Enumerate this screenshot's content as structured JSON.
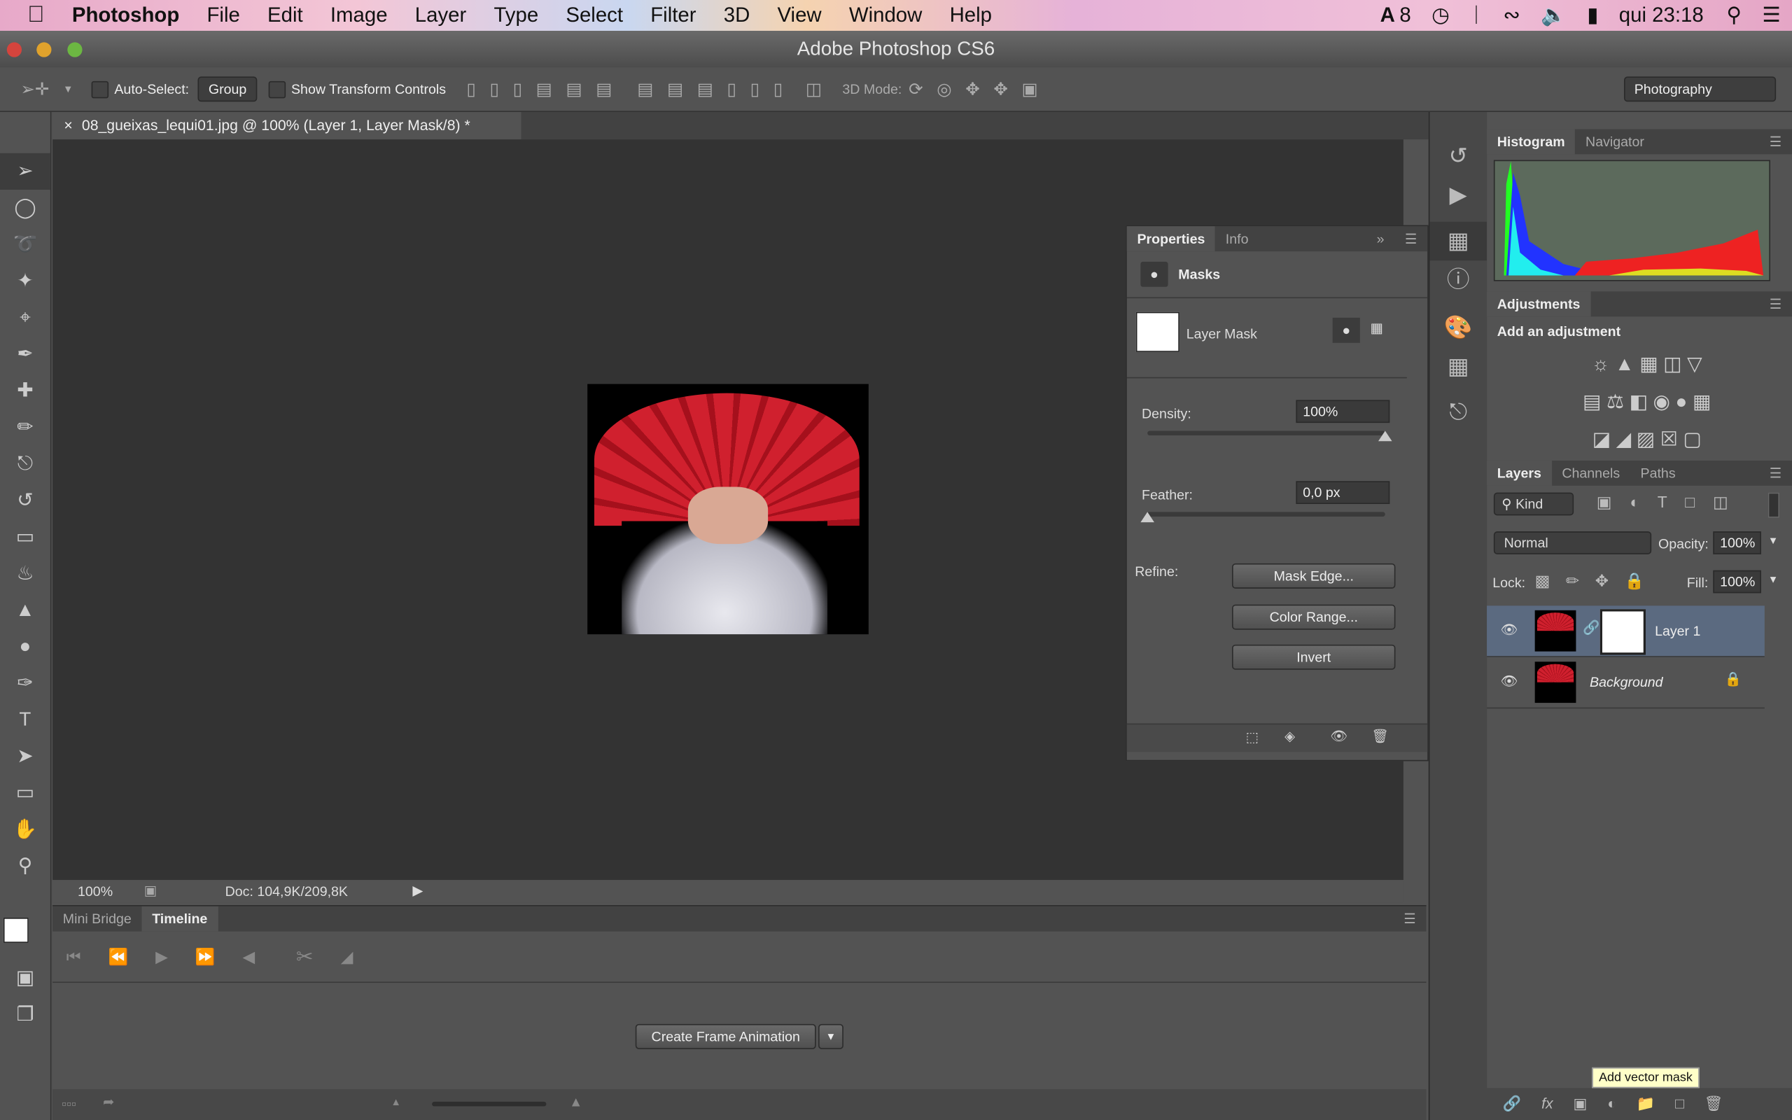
{
  "menubar": {
    "app": "Photoshop",
    "items": [
      "File",
      "Edit",
      "Image",
      "Layer",
      "Type",
      "Select",
      "Filter",
      "3D",
      "View",
      "Window",
      "Help"
    ],
    "adobe_count": "8",
    "clock": "qui 23:18"
  },
  "window": {
    "title": "Adobe Photoshop CS6"
  },
  "options": {
    "auto_select": "Auto-Select:",
    "auto_select_value": "Group",
    "show_transform": "Show Transform Controls",
    "mode_3d": "3D Mode:",
    "workspace": "Photography"
  },
  "document": {
    "tab": "08_gueixas_lequi01.jpg @ 100% (Layer 1, Layer Mask/8) *",
    "zoom": "100%",
    "doc_size": "Doc: 104,9K/209,8K"
  },
  "timeline": {
    "tabs": [
      "Mini Bridge",
      "Timeline"
    ],
    "create_button": "Create Frame Animation"
  },
  "properties": {
    "tabs": [
      "Properties",
      "Info"
    ],
    "section": "Masks",
    "mask_label": "Layer Mask",
    "density_label": "Density:",
    "density": "100%",
    "density_value": 100,
    "feather_label": "Feather:",
    "feather": "0,0 px",
    "feather_value": 0,
    "refine_label": "Refine:",
    "buttons": [
      "Mask Edge...",
      "Color Range...",
      "Invert"
    ]
  },
  "histogram": {
    "tabs": [
      "Histogram",
      "Navigator"
    ]
  },
  "adjustments": {
    "title": "Adjustments",
    "subtitle": "Add an adjustment"
  },
  "layers": {
    "tabs": [
      "Layers",
      "Channels",
      "Paths"
    ],
    "filter": "Kind",
    "blend": "Normal",
    "opacity_label": "Opacity:",
    "opacity": "100%",
    "lock_label": "Lock:",
    "fill_label": "Fill:",
    "fill": "100%",
    "items": [
      {
        "name": "Layer 1",
        "selected": true
      },
      {
        "name": "Background",
        "locked": true
      }
    ]
  },
  "tooltip": "Add vector mask",
  "colors": {
    "accent_selected": "#5b6a80",
    "fan_red": "#d0202e"
  }
}
